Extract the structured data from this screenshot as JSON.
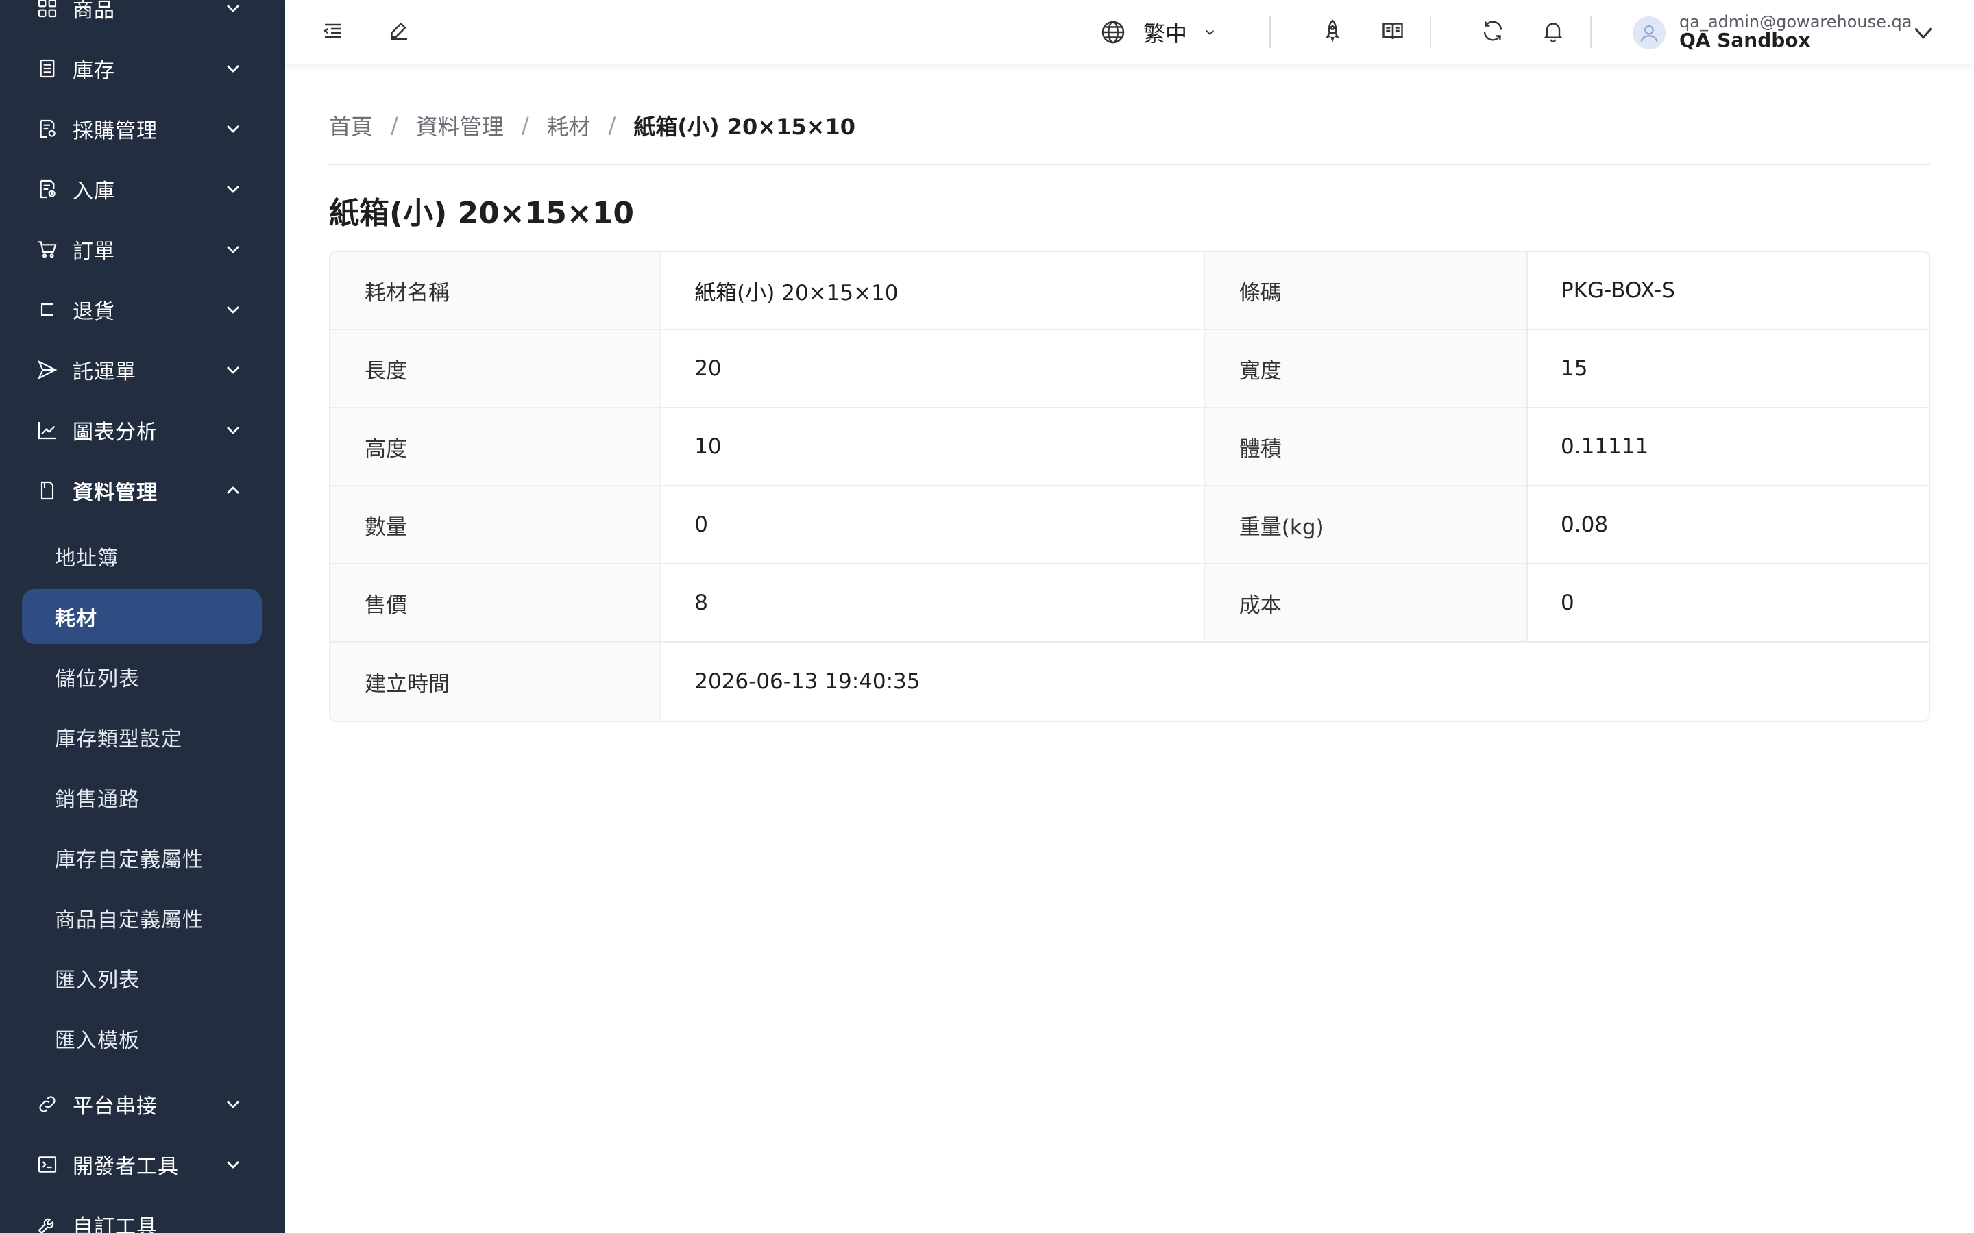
{
  "sidebar": {
    "groups_top": [
      {
        "label": "商品",
        "icon": "grid-icon"
      },
      {
        "label": "庫存",
        "icon": "inventory-icon"
      },
      {
        "label": "採購管理",
        "icon": "purchase-icon"
      },
      {
        "label": "入庫",
        "icon": "inbound-icon"
      },
      {
        "label": "訂單",
        "icon": "cart-icon"
      },
      {
        "label": "退貨",
        "icon": "return-icon"
      },
      {
        "label": "託運單",
        "icon": "send-icon"
      },
      {
        "label": "圖表分析",
        "icon": "chart-icon"
      },
      {
        "label": "資料管理",
        "icon": "document-icon"
      }
    ],
    "sub_items": [
      "地址簿",
      "耗材",
      "儲位列表",
      "庫存類型設定",
      "銷售通路",
      "庫存自定義屬性",
      "商品自定義屬性",
      "匯入列表",
      "匯入模板"
    ],
    "groups_bottom": [
      {
        "label": "平台串接",
        "icon": "link-icon"
      },
      {
        "label": "開發者工具",
        "icon": "terminal-icon"
      },
      {
        "label": "自訂工具",
        "icon": "wrench-icon"
      }
    ]
  },
  "header": {
    "language": "繁中",
    "user_email": "qa_admin@gowarehouse.qa",
    "user_org": "QA Sandbox"
  },
  "breadcrumb": [
    "首頁",
    "資料管理",
    "耗材",
    "紙箱(小) 20×15×10"
  ],
  "page_title": "紙箱(小) 20×15×10",
  "details": {
    "name_label": "耗材名稱",
    "name": "紙箱(小) 20×15×10",
    "barcode_label": "條碼",
    "barcode": "PKG-BOX-S",
    "length_label": "長度",
    "length": "20",
    "width_label": "寬度",
    "width": "15",
    "height_label": "高度",
    "height": "10",
    "volume_label": "體積",
    "volume": "0.11111",
    "quantity_label": "數量",
    "quantity": "0",
    "weight_label": "重量(kg)",
    "weight": "0.08",
    "price_label": "售價",
    "price": "8",
    "cost_label": "成本",
    "cost": "0",
    "created_label": "建立時間",
    "created": "2026-06-13 19:40:35"
  }
}
